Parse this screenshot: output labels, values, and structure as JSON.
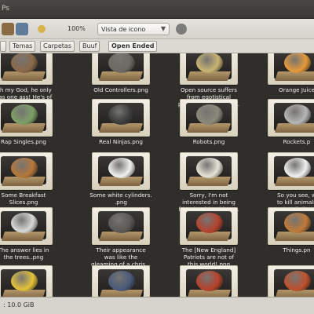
{
  "window": {
    "title": "Ps"
  },
  "toolbar": {
    "zoom_label": "100%",
    "view_mode": "Vista de icono",
    "icons": [
      "home-icon",
      "computer-icon",
      "zoom-out-icon",
      "zoom-in-icon",
      "search-icon"
    ]
  },
  "pathbar": {
    "crumbs": [
      {
        "label": ""
      },
      {
        "label": "Temas"
      },
      {
        "label": "Carpetas"
      },
      {
        "label": "Buuf"
      },
      {
        "label": "Open Ended"
      }
    ]
  },
  "files": [
    {
      "name": "Oh my God, he only\nhas one ass! He's of\nno use to me..png",
      "icon": "face-icon",
      "color": "#8c6a4a"
    },
    {
      "name": "Old Controllers.png",
      "icon": "controller-icon",
      "color": "#6e6a62"
    },
    {
      "name": "Open source suffers\nfrom egotistical\nprogrammers. I gue...",
      "icon": "jar-icon",
      "color": "#c8b472"
    },
    {
      "name": "Orange Juice",
      "icon": "glass-icon",
      "color": "#e59a3a"
    },
    {
      "name": "Rap Singles.png",
      "icon": "money-icon",
      "color": "#7ea067"
    },
    {
      "name": "Real Ninjas.png",
      "icon": "ninja-icon",
      "color": "#3a3a3a"
    },
    {
      "name": "Robots.png",
      "icon": "robot-icon",
      "color": "#8a8a7a"
    },
    {
      "name": "Rockets.p",
      "icon": "rocket-icon",
      "color": "#b6b6b6"
    },
    {
      "name": "Some Breakfast\nSlices.png",
      "icon": "pancakes-icon",
      "color": "#b7773a"
    },
    {
      "name": "Some white cylinders.\n.png",
      "icon": "cylinder-icon",
      "color": "#f1f1ee"
    },
    {
      "name": "Sorry, I'm not\ninterested in being\nfriends with midget...",
      "icon": "shirt-icon",
      "color": "#e8e3d6"
    },
    {
      "name": "So you see, w\nto kill animals\nthey'll die..",
      "icon": "note-icon",
      "color": "#f0f0f0"
    },
    {
      "name": "The answer lies in\nthe trees..png",
      "icon": "cloud-icon",
      "color": "#d9dad7"
    },
    {
      "name": "Their appearance\nwas like the\ngleaming of a chris...",
      "icon": "binoculars-icon",
      "color": "#5c5a56"
    },
    {
      "name": "The [New England]\nPatriots are not of\nthis world!.png",
      "icon": "capsule-icon",
      "color": "#b5432f"
    },
    {
      "name": "Things.pn",
      "icon": "burger-icon",
      "color": "#c07a3a"
    },
    {
      "name": "",
      "icon": "warning-icon",
      "color": "#e3c23a"
    },
    {
      "name": "",
      "icon": "batman-icon",
      "color": "#4a5a7a"
    },
    {
      "name": "",
      "icon": "ball-icon",
      "color": "#b7422c"
    },
    {
      "name": "",
      "icon": "crab-icon",
      "color": "#c0512e"
    }
  ],
  "status": {
    "text": ": 10.0 GiB"
  }
}
